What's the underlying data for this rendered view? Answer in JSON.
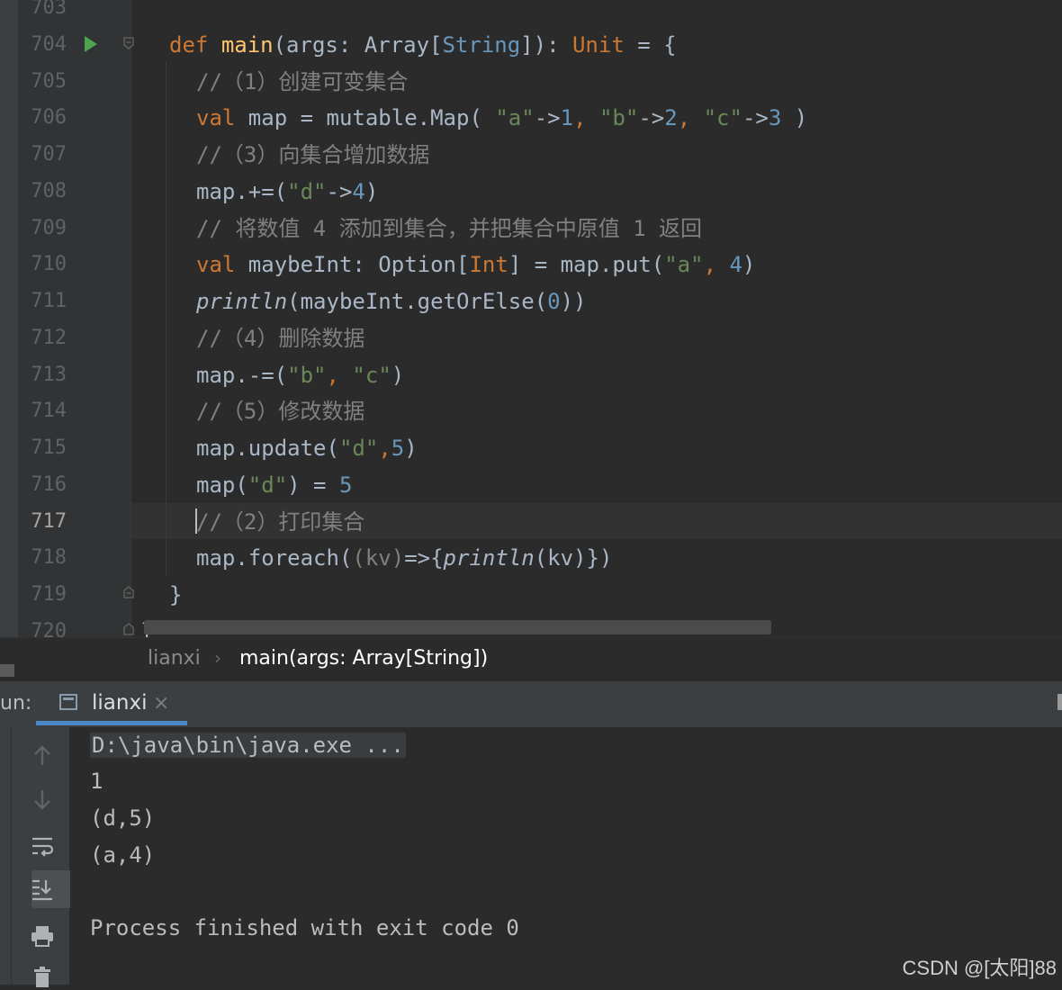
{
  "editor": {
    "lines": [
      {
        "num": "703",
        "current": false
      },
      {
        "num": "704",
        "current": false
      },
      {
        "num": "705",
        "current": false
      },
      {
        "num": "706",
        "current": false
      },
      {
        "num": "707",
        "current": false
      },
      {
        "num": "708",
        "current": false
      },
      {
        "num": "709",
        "current": false
      },
      {
        "num": "710",
        "current": false
      },
      {
        "num": "711",
        "current": false
      },
      {
        "num": "712",
        "current": false
      },
      {
        "num": "713",
        "current": false
      },
      {
        "num": "714",
        "current": false
      },
      {
        "num": "715",
        "current": false
      },
      {
        "num": "716",
        "current": false
      },
      {
        "num": "717",
        "current": true
      },
      {
        "num": "718",
        "current": false
      },
      {
        "num": "719",
        "current": false
      },
      {
        "num": "720",
        "current": false
      }
    ],
    "code": {
      "l704": {
        "kw": "def",
        "fn": "main",
        "p1": "(args: ",
        "t1": "Array",
        "b1": "[",
        "t2": "String",
        "b2": "]): ",
        "t3": "Unit",
        "rest": " = {"
      },
      "l705": "//（1）创建可变集合",
      "l706": {
        "kw": "val",
        "a": " map = mutable.Map( ",
        "s1": "\"a\"",
        "o1": "->",
        "n1": "1",
        "c1": ", ",
        "s2": "\"b\"",
        "o2": "->",
        "n2": "2",
        "c2": ", ",
        "s3": "\"c\"",
        "o3": "->",
        "n3": "3",
        "end": " )"
      },
      "l707": "//（3）向集合增加数据",
      "l708": {
        "a": "map.+=(",
        "s1": "\"d\"",
        "o1": "->",
        "n1": "4",
        "end": ")"
      },
      "l709": "// 将数值 4 添加到集合，并把集合中原值 1 返回",
      "l710": {
        "kw": "val",
        "a": " maybeInt: Option[",
        "t1": "Int",
        "b": "] = map.put(",
        "s1": "\"a\"",
        "c": ", ",
        "n1": "4",
        "end": ")"
      },
      "l711": {
        "it": "println",
        "a": "(maybeInt.getOrElse(",
        "n1": "0",
        "end": "))"
      },
      "l712": "//（4）删除数据",
      "l713": {
        "a": "map.-=(",
        "s1": "\"b\"",
        "c": ", ",
        "s2": "\"c\"",
        "end": ")"
      },
      "l714": "//（5）修改数据",
      "l715": {
        "a": "map.update(",
        "s1": "\"d\"",
        "c": ",",
        "n1": "5",
        "end": ")"
      },
      "l716": {
        "a": "map(",
        "s1": "\"d\"",
        "b": ") = ",
        "n1": "5"
      },
      "l717": "//（2）打印集合",
      "l718": {
        "a": "map.foreach(",
        "p": "(kv)",
        "b": "=>{",
        "it": "println",
        "c": "(kv)})"
      },
      "l719": "}",
      "l720": "}"
    }
  },
  "breadcrumb": {
    "file": "lianxi",
    "sep": "›",
    "method": "main(args: Array[String])"
  },
  "run": {
    "label": "un:",
    "tab_label": "lianxi",
    "tab_close": "×",
    "toolbar_icons": [
      "arrow-up-icon",
      "arrow-down-icon",
      "soft-wrap-icon",
      "scroll-to-end-icon",
      "print-icon",
      "trash-icon"
    ],
    "output": {
      "cmd": "D:\\java\\bin\\java.exe ...",
      "lines": [
        "1",
        "(d,5)",
        "(a,4)"
      ],
      "exit": "Process finished with exit code 0"
    }
  },
  "watermark": "CSDN @[太阳]88",
  "colors": {
    "background": "#2b2b2b",
    "keyword": "#cc7832",
    "string": "#6a8759",
    "number": "#6897bb",
    "comment": "#808080",
    "function": "#ffc66d",
    "accent": "#4a88c7"
  }
}
